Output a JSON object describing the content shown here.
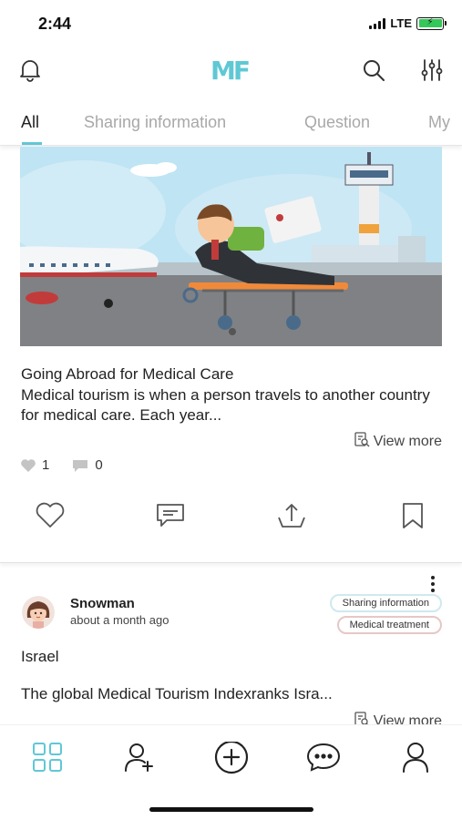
{
  "status_bar": {
    "time": "2:44",
    "network": "LTE"
  },
  "header": {
    "logo_text": "MF",
    "icons": {
      "left": "bell-icon",
      "search": "search-icon",
      "filter": "sliders-icon"
    }
  },
  "tabs": [
    {
      "label": "All",
      "active": true
    },
    {
      "label": "Sharing information",
      "active": false
    },
    {
      "label": "Question",
      "active": false
    },
    {
      "label": "My",
      "active": false
    }
  ],
  "post1": {
    "title": "Going Abroad for Medical Care",
    "body": "Medical tourism is when a person travels to another country for medical care. Each year...",
    "view_more": "View more",
    "likes": "1",
    "comments": "0",
    "actions": [
      "heart-icon",
      "comment-icon",
      "share-icon",
      "bookmark-icon"
    ]
  },
  "post2": {
    "username": "Snowman",
    "time_ago": "about a month ago",
    "tags": [
      "Sharing information",
      "Medical treatment"
    ],
    "location": "Israel",
    "body": "The global Medical Tourism Indexranks Isra...",
    "view_more": "View more"
  },
  "bottom_nav": [
    "grid-icon",
    "add-friend-icon",
    "add-post-icon",
    "chat-icon",
    "profile-icon"
  ],
  "colors": {
    "accent": "#5fc8d5",
    "tag1_border": "#cfe9ee",
    "tag2_border": "#e6c7c7",
    "battery": "#34c759"
  }
}
